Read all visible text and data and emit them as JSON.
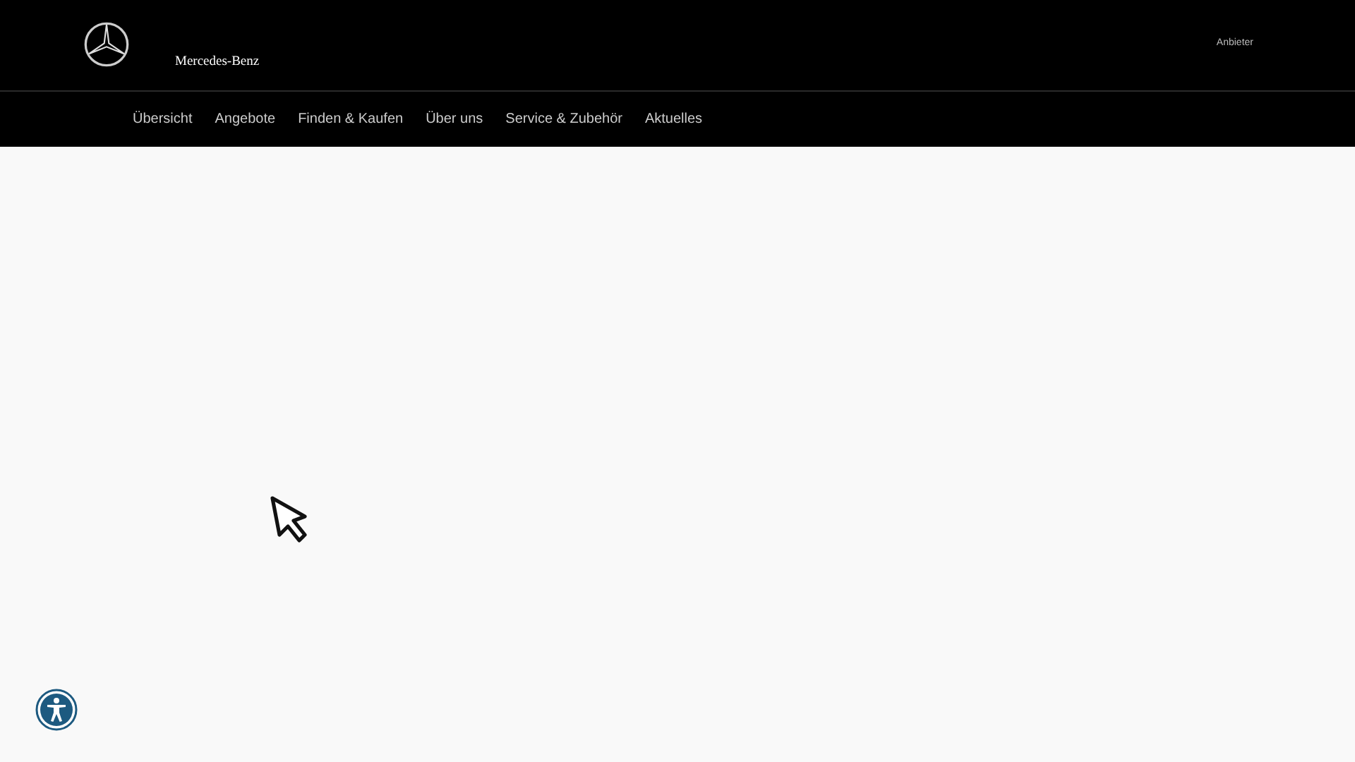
{
  "header": {
    "brand": "Mercedes-Benz",
    "provider_link": "Anbieter"
  },
  "nav": {
    "items": [
      {
        "label": "Übersicht"
      },
      {
        "label": "Angebote"
      },
      {
        "label": "Finden & Kaufen"
      },
      {
        "label": "Über uns"
      },
      {
        "label": "Service & Zubehör"
      },
      {
        "label": "Aktuelles"
      }
    ]
  }
}
